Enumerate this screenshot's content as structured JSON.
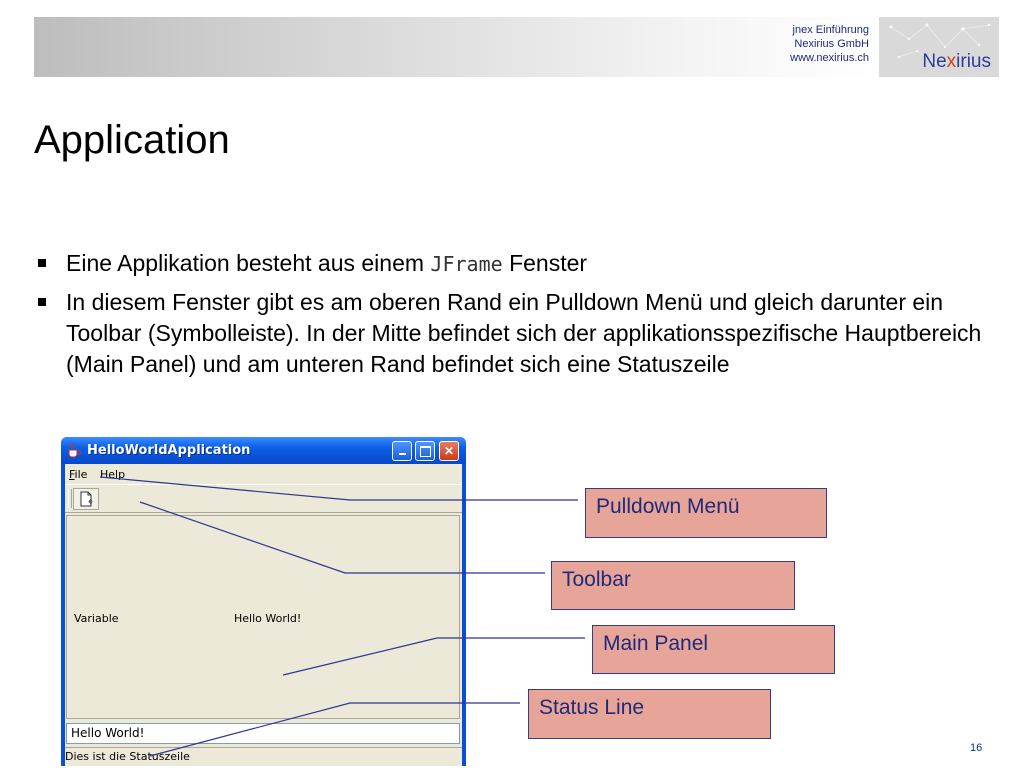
{
  "header": {
    "lines": [
      "jnex Einführung",
      "Nexirius GmbH",
      "www.nexirius.ch"
    ],
    "logo_text_a": "Ne",
    "logo_text_x": "x",
    "logo_text_b": "irius",
    "colors": {
      "text": "#1f2a7a",
      "logo_blue": "#2c3c9c",
      "logo_accent": "#d0421b"
    }
  },
  "slide": {
    "title": "Application",
    "bullet1_a": "Eine Applikation besteht aus einem",
    "bullet1_code": "JFrame",
    "bullet1_b": "Fenster",
    "bullet2": "In diesem Fenster gibt es am oberen Rand ein Pulldown Menü und gleich darunter ein Toolbar (Symbolleiste). In der Mitte befindet sich der applikationsspezifische Hauptbereich (Main Panel) und am unteren Rand befindet sich eine Statuszeile",
    "page_number": "16"
  },
  "window": {
    "title": "HelloWorldApplication",
    "menu": [
      {
        "label_u": "F",
        "label_rest": "ile"
      },
      {
        "label_u": "",
        "label_rest": "Help"
      }
    ],
    "panel_left_label": "Variable",
    "panel_right_label": "Hello World!",
    "text_field_value": "Hello World!",
    "status_text": "Dies ist die Statuszeile",
    "icons": [
      "java-cup-icon",
      "minimize-icon",
      "maximize-icon",
      "close-icon",
      "new-document-icon"
    ]
  },
  "callouts": {
    "pulldown": "Pulldown Menü",
    "toolbar": "Toolbar",
    "main_panel": "Main Panel",
    "status_line": "Status Line",
    "fill_color": "#e6a598",
    "line_color": "#2f3590"
  }
}
